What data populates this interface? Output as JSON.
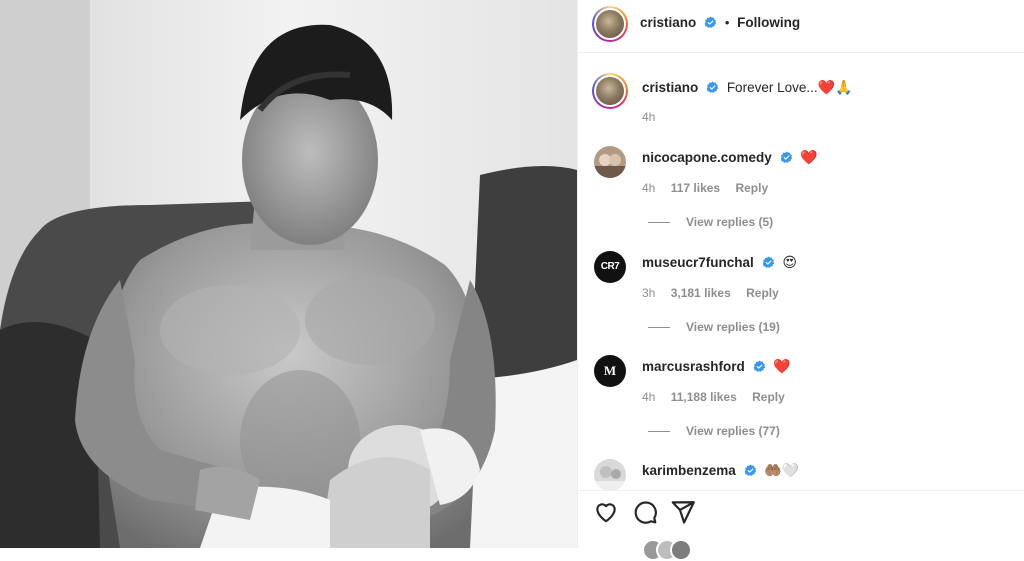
{
  "post": {
    "username": "cristiano",
    "follow_status": "Following",
    "caption": "Forever Love...",
    "caption_emojis": "❤️🙏",
    "time": "4h"
  },
  "comments": [
    {
      "username": "nicocapone.comedy",
      "emoji": "❤️",
      "time": "4h",
      "likes": "117 likes",
      "reply": "Reply",
      "view_replies": "View replies (5)",
      "avatar_color": "#b49a86"
    },
    {
      "username": "museucr7funchal",
      "emoji": "😍",
      "time": "3h",
      "likes": "3,181 likes",
      "reply": "Reply",
      "view_replies": "View replies (19)",
      "avatar_label": "CR7",
      "avatar_color": "#111111"
    },
    {
      "username": "marcusrashford",
      "emoji": "❤️",
      "time": "4h",
      "likes": "11,188 likes",
      "reply": "Reply",
      "view_replies": "View replies (77)",
      "avatar_label": "M",
      "avatar_color": "#111111"
    },
    {
      "username": "karimbenzema",
      "emoji": "🤲🏽🤍",
      "avatar_color": "#d9d9d9"
    }
  ],
  "actions": {
    "like_icon": "heart-icon",
    "comment_icon": "comment-bubble-icon",
    "share_icon": "paper-plane-icon"
  },
  "colors": {
    "verified_blue": "#3897f0",
    "muted_text": "#8e8e8e",
    "primary_text": "#262626"
  }
}
